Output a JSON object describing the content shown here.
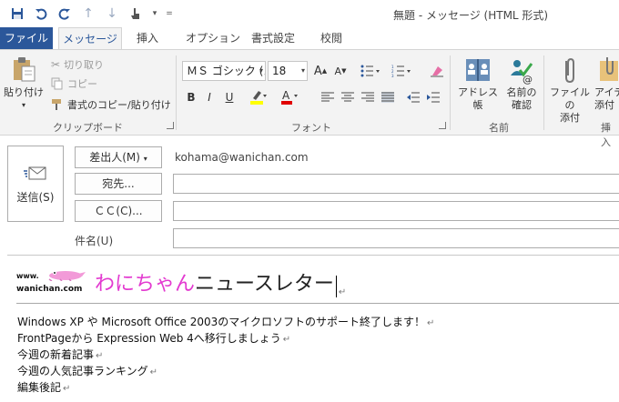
{
  "window": {
    "title": "無題 - メッセージ (HTML 形式)"
  },
  "qat": {
    "items": [
      "save-icon",
      "undo-icon",
      "redo-icon",
      "up-icon",
      "down-icon",
      "touch-mode-icon",
      "customize-icon"
    ]
  },
  "tabs": [
    {
      "label": "ファイル",
      "active": false
    },
    {
      "label": "メッセージ",
      "active": true
    },
    {
      "label": "挿入",
      "active": false
    },
    {
      "label": "オプション",
      "active": false
    },
    {
      "label": "書式設定",
      "active": false
    },
    {
      "label": "校閲",
      "active": false
    }
  ],
  "ribbon": {
    "clipboard": {
      "paste_label": "貼り付け",
      "cut_label": "切り取り",
      "copy_label": "コピー",
      "format_painter_label": "書式のコピー/貼り付け",
      "group_label": "クリップボード"
    },
    "font": {
      "font_name": "ＭＳ ゴシック (ス",
      "font_size": "18",
      "group_label": "フォント"
    },
    "names": {
      "address_book_label": "アドレス帳",
      "check_names_label": "名前の\n確認",
      "check_names_line1": "名前の",
      "check_names_line2": "確認",
      "group_label": "名前"
    },
    "include": {
      "attach_file_line1": "ファイルの",
      "attach_file_line2": "添付",
      "attach_item_line1": "アイテ",
      "attach_item_line2": "添付",
      "group_label": "挿入"
    }
  },
  "header": {
    "send_label": "送信(S)",
    "from_label": "差出人(M)",
    "from_value": "kohama@wanichan.com",
    "to_label": "宛先...",
    "cc_label": "ＣＣ(C)...",
    "subject_label": "件名(U)",
    "to_value": "",
    "cc_value": "",
    "subject_value": ""
  },
  "body": {
    "logo_line1": "www.",
    "logo_line2": "wanichan.com",
    "title_pink": "わにちゃん",
    "title_black": "ニュースレター",
    "lines": [
      "Windows XP や Microsoft Office 2003のマイクロソフトのサポート終了します！",
      "FrontPageから Expression Web 4へ移行しましょう",
      "今週の新着記事",
      "今週の人気記事ランキング",
      "編集後記"
    ]
  },
  "colors": {
    "accent": "#2b579a",
    "title_pink": "#e33ad0",
    "highlight_yellow": "#ffff00",
    "font_red": "#e00000"
  }
}
